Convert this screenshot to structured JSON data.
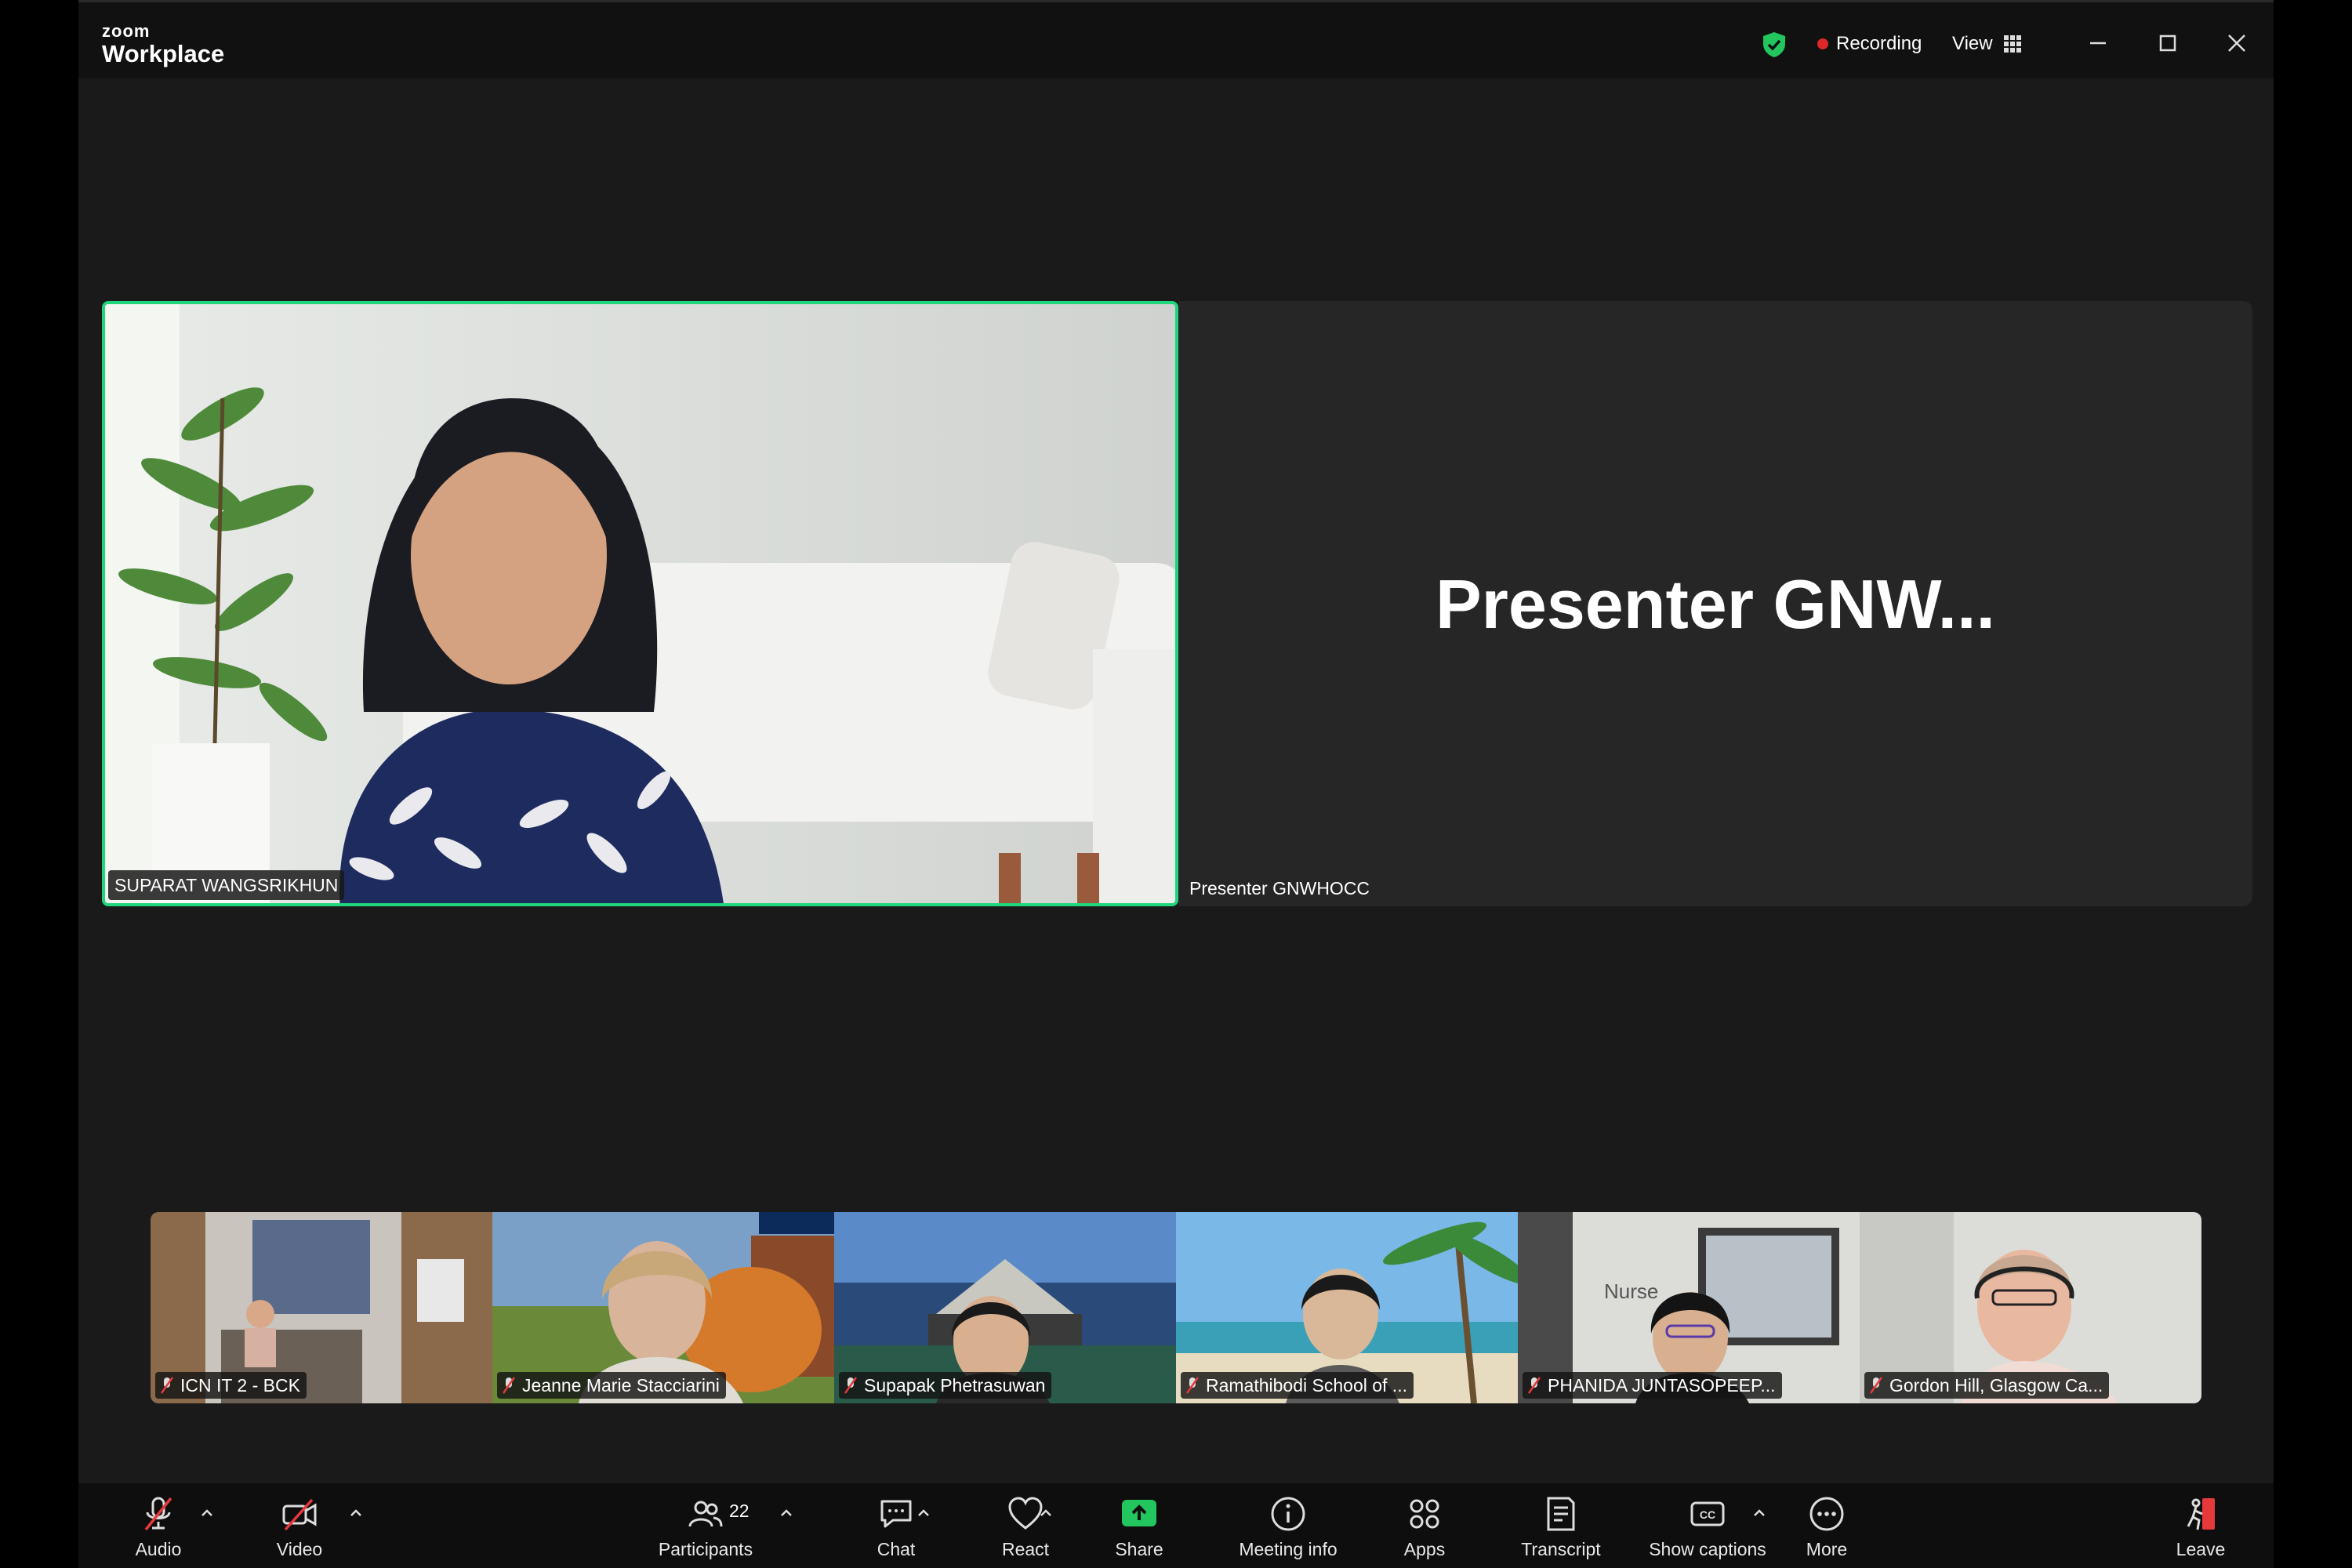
{
  "app": {
    "brand_top": "zoom",
    "brand_bottom": "Workplace"
  },
  "titlebar": {
    "recording_label": "Recording",
    "view_label": "View"
  },
  "stage": {
    "speaker_name": "SUPARAT WANGSRIKHUN",
    "presenter_display": "Presenter  GNW...",
    "presenter_name": "Presenter GNWHOCC"
  },
  "filmstrip": [
    {
      "name": "ICN IT 2 - BCK"
    },
    {
      "name": "Jeanne Marie Stacciarini"
    },
    {
      "name": "Supapak Phetrasuwan"
    },
    {
      "name": "Ramathibodi School of ..."
    },
    {
      "name": "PHANIDA JUNTASOPEEP..."
    },
    {
      "name": "Gordon Hill, Glasgow Ca..."
    }
  ],
  "toolbar": {
    "audio": "Audio",
    "video": "Video",
    "participants": "Participants",
    "participants_count": "22",
    "chat": "Chat",
    "react": "React",
    "share": "Share",
    "meeting_info": "Meeting info",
    "apps": "Apps",
    "transcript": "Transcript",
    "captions": "Show captions",
    "more": "More",
    "leave": "Leave"
  },
  "colors": {
    "active_speaker_border": "#1fd67c",
    "share_green": "#22c55e",
    "leave_red": "#e5393b",
    "recording_dot": "#e02828"
  }
}
